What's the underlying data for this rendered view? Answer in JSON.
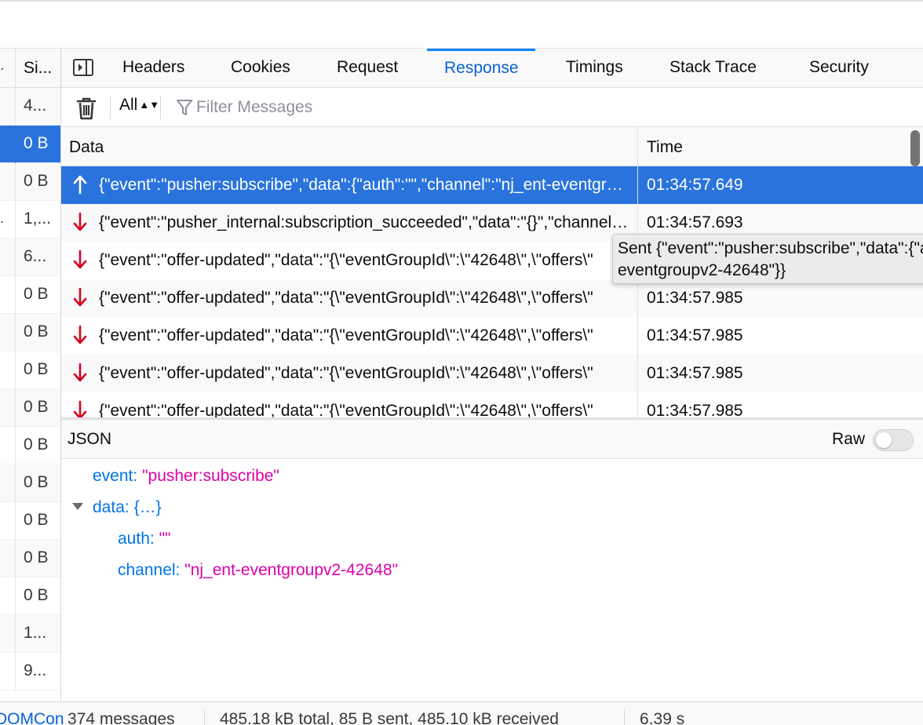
{
  "colors": {
    "accent": "#0a84ff",
    "selected": "#2a73dd",
    "json_key": "#0074e8",
    "json_string": "#dd00a9",
    "received_arrow": "#d70022"
  },
  "request_list": {
    "header": "Si...",
    "rows": [
      {
        "size": "4...",
        "mark": ""
      },
      {
        "size": "0 B",
        "mark": "",
        "selected": true
      },
      {
        "size": "0 B",
        "mark": ""
      },
      {
        "size": "1,...",
        "mark": "."
      },
      {
        "size": "6...",
        "mark": ""
      },
      {
        "size": "0 B",
        "mark": ""
      },
      {
        "size": "0 B",
        "mark": ""
      },
      {
        "size": "0 B",
        "mark": ""
      },
      {
        "size": "0 B",
        "mark": ""
      },
      {
        "size": "0 B",
        "mark": ""
      },
      {
        "size": "0 B",
        "mark": ""
      },
      {
        "size": "0 B",
        "mark": ""
      },
      {
        "size": "0 B",
        "mark": ""
      },
      {
        "size": "0 B",
        "mark": ""
      },
      {
        "size": "1...",
        "mark": ""
      },
      {
        "size": "9...",
        "mark": ""
      }
    ]
  },
  "tabs": [
    {
      "label": "Headers"
    },
    {
      "label": "Cookies"
    },
    {
      "label": "Request"
    },
    {
      "label": "Response",
      "active": true
    },
    {
      "label": "Timings"
    },
    {
      "label": "Stack Trace"
    },
    {
      "label": "Security"
    }
  ],
  "toolbar": {
    "filter_value": "All",
    "filter_placeholder": "Filter Messages"
  },
  "messages": {
    "columns": {
      "data": "Data",
      "time": "Time"
    },
    "rows": [
      {
        "dir": "sent",
        "data": "{\"event\":\"pusher:subscribe\",\"data\":{\"auth\":\"\",\"channel\":\"nj_ent-eventgroupv2-42648\"}}",
        "time": "01:34:57.649",
        "selected": true
      },
      {
        "dir": "received",
        "data": "{\"event\":\"pusher_internal:subscription_succeeded\",\"data\":\"{}\",\"channel\":\"nj_ent-eventgroupv2-42648\"}",
        "time": "01:34:57.693"
      },
      {
        "dir": "received",
        "data": "{\"event\":\"offer-updated\",\"data\":\"{\\\"eventGroupId\\\":\\\"42648\\\",\\\"offers\\\"",
        "time": "01:34:57.985"
      },
      {
        "dir": "received",
        "data": "{\"event\":\"offer-updated\",\"data\":\"{\\\"eventGroupId\\\":\\\"42648\\\",\\\"offers\\\"",
        "time": "01:34:57.985"
      },
      {
        "dir": "received",
        "data": "{\"event\":\"offer-updated\",\"data\":\"{\\\"eventGroupId\\\":\\\"42648\\\",\\\"offers\\\"",
        "time": "01:34:57.985"
      },
      {
        "dir": "received",
        "data": "{\"event\":\"offer-updated\",\"data\":\"{\\\"eventGroupId\\\":\\\"42648\\\",\\\"offers\\\"",
        "time": "01:34:57.985"
      },
      {
        "dir": "received",
        "data": "{\"event\":\"offer-updated\",\"data\":\"{\\\"eventGroupId\\\":\\\"42648\\\",\\\"offers\\\"",
        "time": "01:34:57.985"
      }
    ]
  },
  "tooltip": {
    "line1": "Sent {\"event\":\"pusher:subscribe\",\"data\":{\"auth\":\"\",\"channel\":\"nj_ent-",
    "line2": "eventgroupv2-42648\"}}"
  },
  "json_panel": {
    "title": "JSON",
    "raw_label": "Raw",
    "raw_on": false,
    "event_key": "event:",
    "event_value": "\"pusher:subscribe\"",
    "data_key": "data:",
    "data_summary": "{…}",
    "auth_key": "auth:",
    "auth_value": "\"\"",
    "channel_key": "channel:",
    "channel_value": "\"nj_ent-eventgroupv2-42648\""
  },
  "status": {
    "cut_text": "DOMCon",
    "messages": "374 messages",
    "transfer": "485.18 kB total, 85 B sent, 485.10 kB received",
    "duration": "6.39 s"
  }
}
